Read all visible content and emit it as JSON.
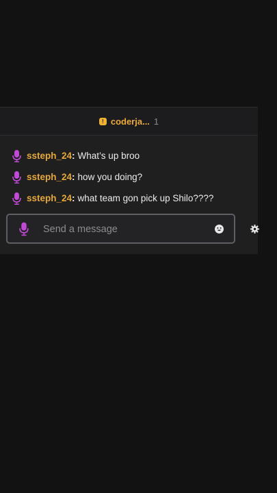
{
  "header": {
    "pinned_user": "coderja...",
    "count": "1"
  },
  "messages": [
    {
      "username": "ssteph_24",
      "separator": ":",
      "text": "What’s up broo"
    },
    {
      "username": "ssteph_24",
      "separator": ":",
      "text": "how you doing?"
    },
    {
      "username": "ssteph_24",
      "separator": ":",
      "text": "what team gon pick up Shilo????"
    }
  ],
  "input": {
    "placeholder": "Send a message",
    "value": ""
  },
  "icons": {
    "pin": "pin-badge-icon",
    "mic": "microphone-icon",
    "emoji": "smiley-icon",
    "settings": "gear-icon"
  },
  "colors": {
    "username": "#e6a83b",
    "mic": "#c04ad6",
    "panel_bg": "#1f1f20",
    "pin_badge": "#f0b232"
  }
}
